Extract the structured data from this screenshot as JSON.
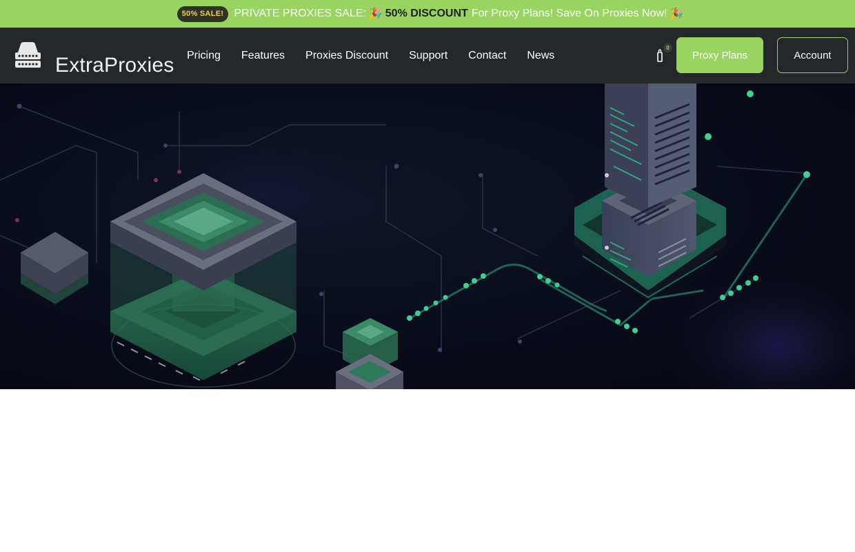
{
  "promo": {
    "badge": "50% SALE!",
    "lead": "PRIVATE PROXIES SALE:",
    "emoji_left": "🎉",
    "highlight": "50% DISCOUNT",
    "tail": "For Proxy Plans! Save On Proxies Now!",
    "emoji_right": "🎉"
  },
  "brand": {
    "name": "ExtraProxies",
    "icon": "server-icon"
  },
  "menu": [
    {
      "label": "Pricing"
    },
    {
      "label": "Features"
    },
    {
      "label": "Proxies Discount"
    },
    {
      "label": "Support"
    },
    {
      "label": "Contact"
    },
    {
      "label": "News"
    }
  ],
  "cart": {
    "icon": "cart-icon",
    "count": "0"
  },
  "buttons": {
    "proxy_plans": "Proxy Plans",
    "account": "Account"
  },
  "colors": {
    "accent": "#98d45f",
    "nav_bg": "#25282b",
    "hero_bg": "#090c19",
    "badge_bg": "#2e3128",
    "badge_text": "#f2d33c"
  }
}
